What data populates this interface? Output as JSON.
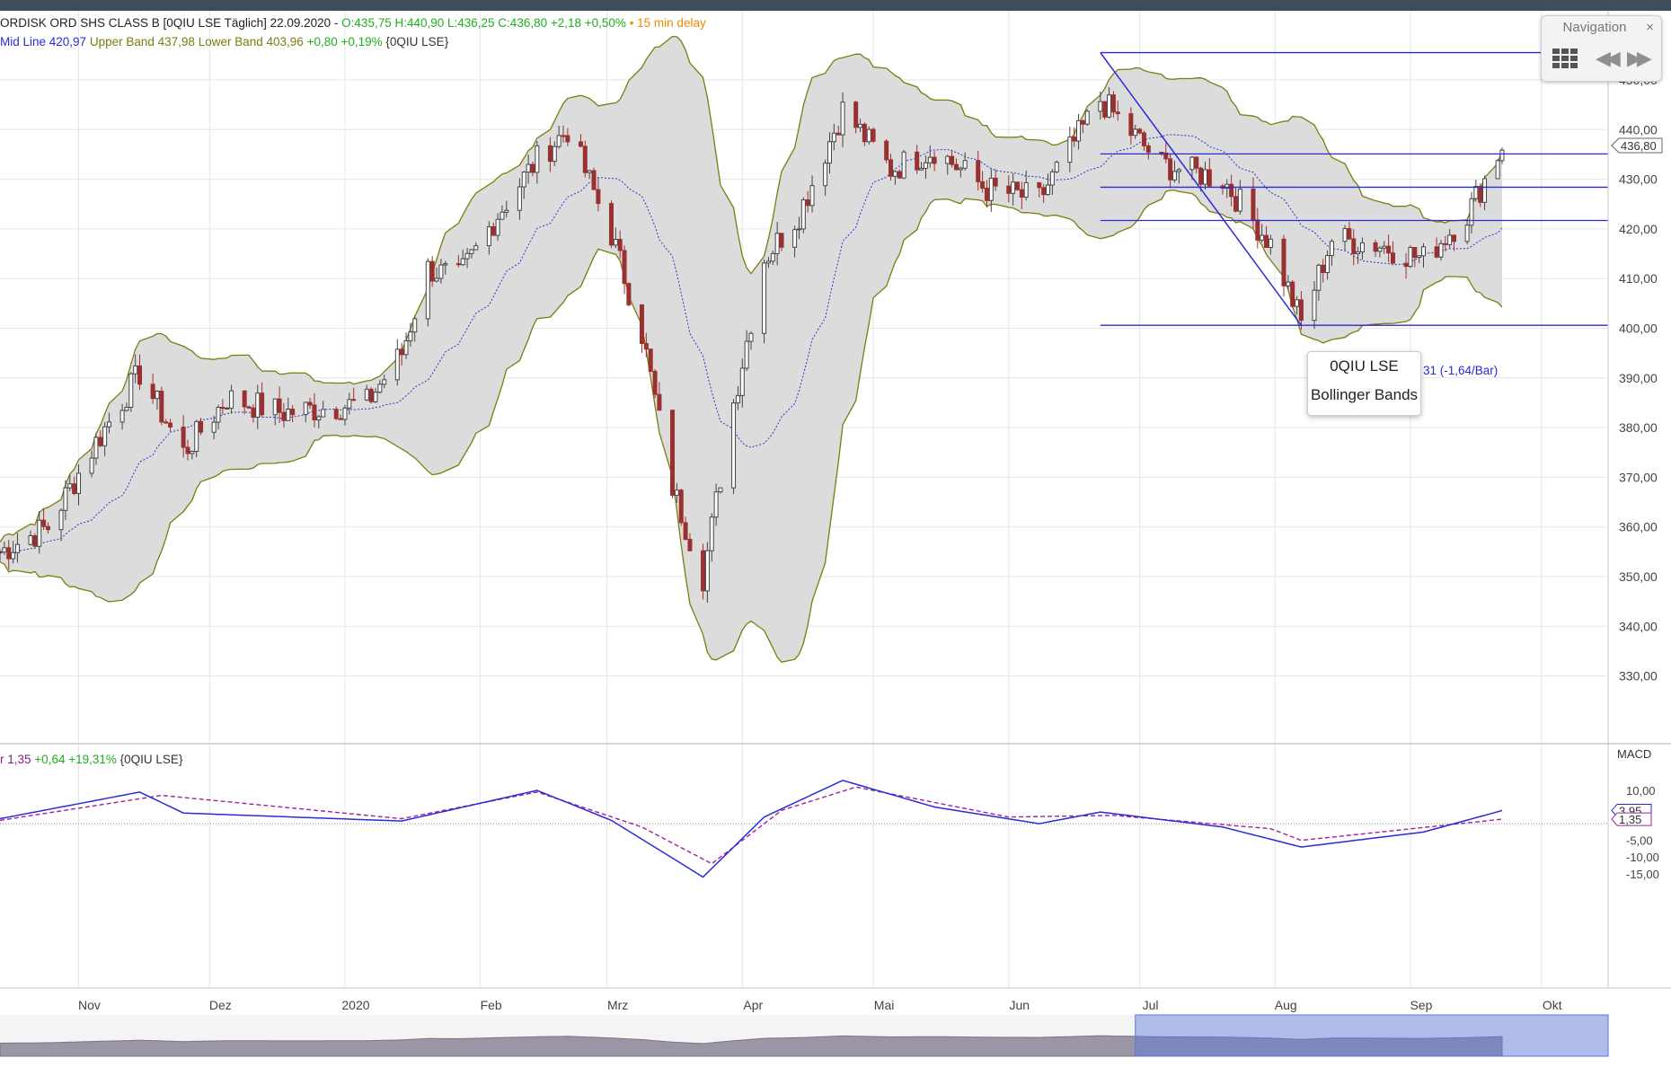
{
  "header": {
    "title": "ORDISK ORD SHS CLASS B [0QIU LSE Täglich] 22.09.2020 - ",
    "ohlc": "O:435,75 H:440,90 L:436,25 C:436,80 +2,18 +0,50%",
    "delay": "• 15 min delay"
  },
  "bb_legend": {
    "mid": "Mid Line 420,97",
    "upper": "Upper Band 437,98",
    "lower": "Lower Band 403,96",
    "change": "+0,80 +0,19%",
    "symbol": "{0QIU LSE}"
  },
  "macd_legend": {
    "value": "r 1,35",
    "change": "+0,64 +19,31%",
    "symbol": "{0QIU LSE}"
  },
  "navigation": {
    "title": "Navigation",
    "close": "×",
    "back": "◀◀",
    "forward": "▶▶"
  },
  "tooltip": {
    "line1": "0QIU LSE",
    "line2": "Bollinger Bands",
    "extra": "31 (-1,64/Bar)"
  },
  "price_axis": {
    "ticks": [
      "450,00",
      "440,00",
      "430,00",
      "420,00",
      "410,00",
      "400,00",
      "390,00",
      "380,00",
      "370,00",
      "360,00",
      "350,00",
      "340,00",
      "330,00"
    ],
    "current": "436,80",
    "partial_top": "0"
  },
  "macd_axis": {
    "title": "MACD",
    "ticks": [
      "10,00",
      "-5,00",
      "-10,00",
      "-15,00"
    ],
    "label_a": "3,95",
    "label_b": "1,35"
  },
  "months": [
    "Nov",
    "Dez",
    "2020",
    "Feb",
    "Mrz",
    "Apr",
    "Mai",
    "Jun",
    "Jul",
    "Aug",
    "Sep",
    "Okt"
  ],
  "colors": {
    "candle_up": "#444444",
    "candle_down": "#9a3030",
    "band_fill": "#dcdcdc",
    "band_line": "#7c7c0c",
    "mid_line": "#3030d0",
    "macd": "#2a2ad8",
    "signal": "#a0229a",
    "grid": "#e6e6e6"
  },
  "chart_data": {
    "type": "candlestick",
    "y_range": [
      325,
      460
    ],
    "date_range": [
      "2019-10-14",
      "2020-09-22"
    ],
    "close_path": [
      [
        "2019-10-14",
        355
      ],
      [
        "2019-10-25",
        360
      ],
      [
        "2019-11-05",
        377
      ],
      [
        "2019-11-15",
        391
      ],
      [
        "2019-11-25",
        375
      ],
      [
        "2019-12-05",
        386
      ],
      [
        "2019-12-18",
        383
      ],
      [
        "2020-01-06",
        385
      ],
      [
        "2020-01-14",
        395
      ],
      [
        "2020-01-20",
        412
      ],
      [
        "2020-01-27",
        410
      ],
      [
        "2020-02-05",
        423
      ],
      [
        "2020-02-14",
        434
      ],
      [
        "2020-02-21",
        440
      ],
      [
        "2020-03-02",
        419
      ],
      [
        "2020-03-09",
        399
      ],
      [
        "2020-03-16",
        368
      ],
      [
        "2020-03-23",
        350
      ],
      [
        "2020-03-30",
        385
      ],
      [
        "2020-04-06",
        414
      ],
      [
        "2020-04-14",
        423
      ],
      [
        "2020-04-24",
        444
      ],
      [
        "2020-05-05",
        432
      ],
      [
        "2020-05-15",
        436
      ],
      [
        "2020-05-27",
        428
      ],
      [
        "2020-06-08",
        426
      ],
      [
        "2020-06-22",
        446
      ],
      [
        "2020-07-06",
        433
      ],
      [
        "2020-07-20",
        430
      ],
      [
        "2020-07-31",
        417
      ],
      [
        "2020-08-07",
        401
      ],
      [
        "2020-08-14",
        418
      ],
      [
        "2020-08-24",
        417
      ],
      [
        "2020-09-04",
        414
      ],
      [
        "2020-09-14",
        423
      ],
      [
        "2020-09-22",
        436.8
      ]
    ],
    "bollinger": {
      "mid": 420.97,
      "upper": 437.98,
      "lower": 403.96
    },
    "horizontal_lines": [
      455.5,
      435.1,
      428.4,
      421.7,
      400.6
    ],
    "trend_line": [
      [
        "2020-06-22",
        455.5
      ],
      [
        "2020-08-07",
        400.6
      ]
    ],
    "macd": {
      "macd": [
        [
          "2019-10-14",
          1.5
        ],
        [
          "2019-11-15",
          9.5
        ],
        [
          "2019-11-25",
          3.2
        ],
        [
          "2020-01-14",
          0.8
        ],
        [
          "2020-02-14",
          10
        ],
        [
          "2020-03-02",
          1
        ],
        [
          "2020-03-23",
          -16
        ],
        [
          "2020-04-06",
          2
        ],
        [
          "2020-04-24",
          13
        ],
        [
          "2020-05-15",
          5
        ],
        [
          "2020-06-08",
          0
        ],
        [
          "2020-06-22",
          3.5
        ],
        [
          "2020-07-20",
          -1
        ],
        [
          "2020-08-07",
          -7
        ],
        [
          "2020-09-04",
          -2.5
        ],
        [
          "2020-09-22",
          3.95
        ]
      ],
      "signal": [
        [
          "2019-10-14",
          1
        ],
        [
          "2019-11-20",
          8.5
        ],
        [
          "2020-01-14",
          1.5
        ],
        [
          "2020-02-14",
          9.5
        ],
        [
          "2020-03-09",
          -1
        ],
        [
          "2020-03-25",
          -12
        ],
        [
          "2020-04-10",
          4
        ],
        [
          "2020-04-27",
          11
        ],
        [
          "2020-06-01",
          2
        ],
        [
          "2020-06-25",
          2.5
        ],
        [
          "2020-07-31",
          -1.5
        ],
        [
          "2020-08-07",
          -5
        ],
        [
          "2020-09-22",
          1.35
        ]
      ],
      "y_range": [
        -19,
        16
      ]
    }
  }
}
